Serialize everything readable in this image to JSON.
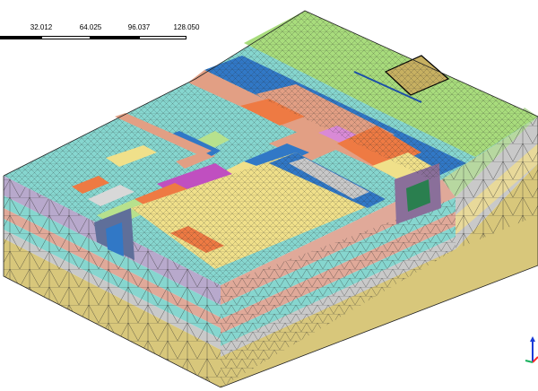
{
  "scale_bar": {
    "labels": [
      "32.012",
      "64.025",
      "96.037",
      "128.050"
    ]
  },
  "colors": {
    "ground_top": "#a8dc7c",
    "ground_side": "#b7d8a0",
    "cyan_layer": "#86d6cf",
    "grey_layer": "#c9c9c9",
    "sand_layer": "#d8c77b",
    "blue_zone": "#3178c6",
    "salmon_zone": "#e29f84",
    "orange_zone": "#ee7a43",
    "pink_zone": "#d98ad6",
    "magenta_zone": "#c04fc0",
    "yellow_zone": "#f0e08a",
    "lightgreen_zone": "#b7e18d",
    "mesh_line": "#2b2b2b",
    "axis_x": "#ff2a2a",
    "axis_y": "#1a3bd8",
    "axis_z": "#19b15d"
  },
  "axis_icons": [
    "axis-x-icon",
    "axis-y-icon",
    "axis-z-icon"
  ]
}
